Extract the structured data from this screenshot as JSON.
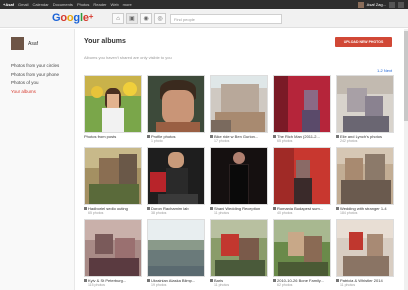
{
  "topbar": {
    "nav": [
      "+Asaf",
      "Gmail",
      "Calendar",
      "Documents",
      "Photos",
      "Reader",
      "Web",
      "more"
    ],
    "user": "Asaf Zag..."
  },
  "header": {
    "logo": {
      "g1": "G",
      "o1": "o",
      "o2": "o",
      "g2": "g",
      "l": "l",
      "e": "e",
      "plus": "+"
    },
    "search_placeholder": "Find people"
  },
  "sidebar": {
    "profile_name": "Asaf",
    "items": [
      "Photos from your circles",
      "Photos from your phone",
      "Photos of you",
      "Your albums"
    ]
  },
  "main": {
    "title": "Your albums",
    "upload_label": "UPLOAD NEW PHOTOS",
    "subtitle": "Albums you haven't shared are only visible to you",
    "pager": "1-2 Next"
  },
  "albums": [
    {
      "title": "Photos from posts",
      "count": ""
    },
    {
      "title": "Profile photos",
      "count": "1 photo"
    },
    {
      "title": "Bike ride w Ben Gurion...",
      "count": "17 photos"
    },
    {
      "title": "The Rich Man (2011-2...",
      "count": "65 photos"
    },
    {
      "title": "Elle and Lynch's photos",
      "count": "242 photos"
    },
    {
      "title": "Hadboriel sedlo outing",
      "count": "65 photos"
    },
    {
      "title": "Doron Rachamim lab",
      "count": "38 photos"
    },
    {
      "title": "Shani Wedding Reception",
      "count": "11 photos"
    },
    {
      "title": "Romania Budapest sum...",
      "count": "40 photos"
    },
    {
      "title": "Wedding with stranger 1-4",
      "count": "184 photos"
    },
    {
      "title": "Kyiv & St Peterburg...",
      "count": "115 photos"
    },
    {
      "title": "Ukrainian Alaska Blimp...",
      "count": "19 photos"
    },
    {
      "title": "Baris",
      "count": "11 photos"
    },
    {
      "title": "2010-10-26 Bone Family...",
      "count": "62 photos"
    },
    {
      "title": "Patricia & Whistler 2014",
      "count": "11 photos"
    }
  ],
  "colors": {
    "accent": "#d14836",
    "topbar": "#2d2d2d",
    "link": "#1a62d6"
  }
}
